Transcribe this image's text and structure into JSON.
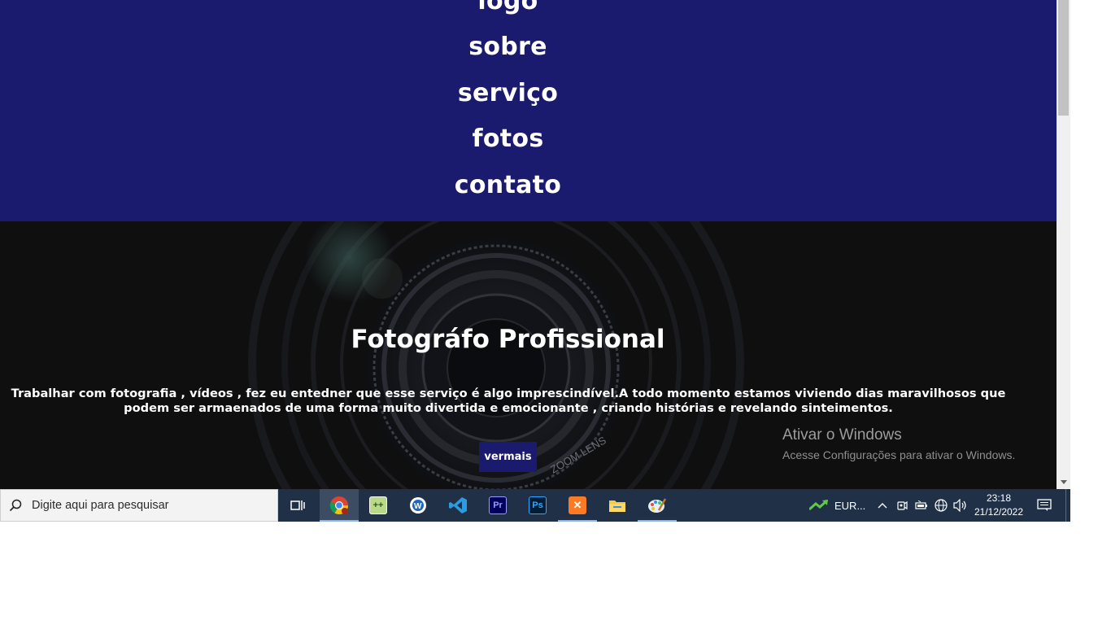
{
  "nav": {
    "items": [
      {
        "label": "logo"
      },
      {
        "label": "sobre"
      },
      {
        "label": "serviço"
      },
      {
        "label": "fotos"
      },
      {
        "label": "contato"
      }
    ]
  },
  "hero": {
    "title": "Fotográfo Profissional",
    "text": "Trabalhar com fotografia , vídeos , fez eu entedner que esse serviço é algo imprescindível.A todo momento estamos viviendo dias maravilhosos que podem ser armaenados de uma forma muito divertida e emocionante , criando histórias e revelando sinteimentos.",
    "button_label": "vermais",
    "lens_text": "ZOOM LENS"
  },
  "watermark": {
    "title": "Ativar o Windows",
    "subtitle": "Acesse Configurações para ativar o Windows."
  },
  "taskbar": {
    "search_placeholder": "Digite aqui para pesquisar",
    "apps": [
      {
        "icon": "task-view-icon"
      },
      {
        "icon": "chrome-icon"
      },
      {
        "icon": "notepad-plus-icon"
      },
      {
        "icon": "word-icon"
      },
      {
        "icon": "vscode-icon"
      },
      {
        "icon": "premiere-icon",
        "text": "Pr"
      },
      {
        "icon": "photoshop-icon",
        "text": "Ps"
      },
      {
        "icon": "xampp-icon"
      },
      {
        "icon": "file-explorer-icon"
      },
      {
        "icon": "paint-icon"
      }
    ],
    "stock_label": "EUR...",
    "time": "23:18",
    "date": "21/12/2022"
  },
  "colors": {
    "nav_bg": "#1a1a6e",
    "hero_bg": "#101010",
    "taskbar_bg": "#1f3047"
  }
}
